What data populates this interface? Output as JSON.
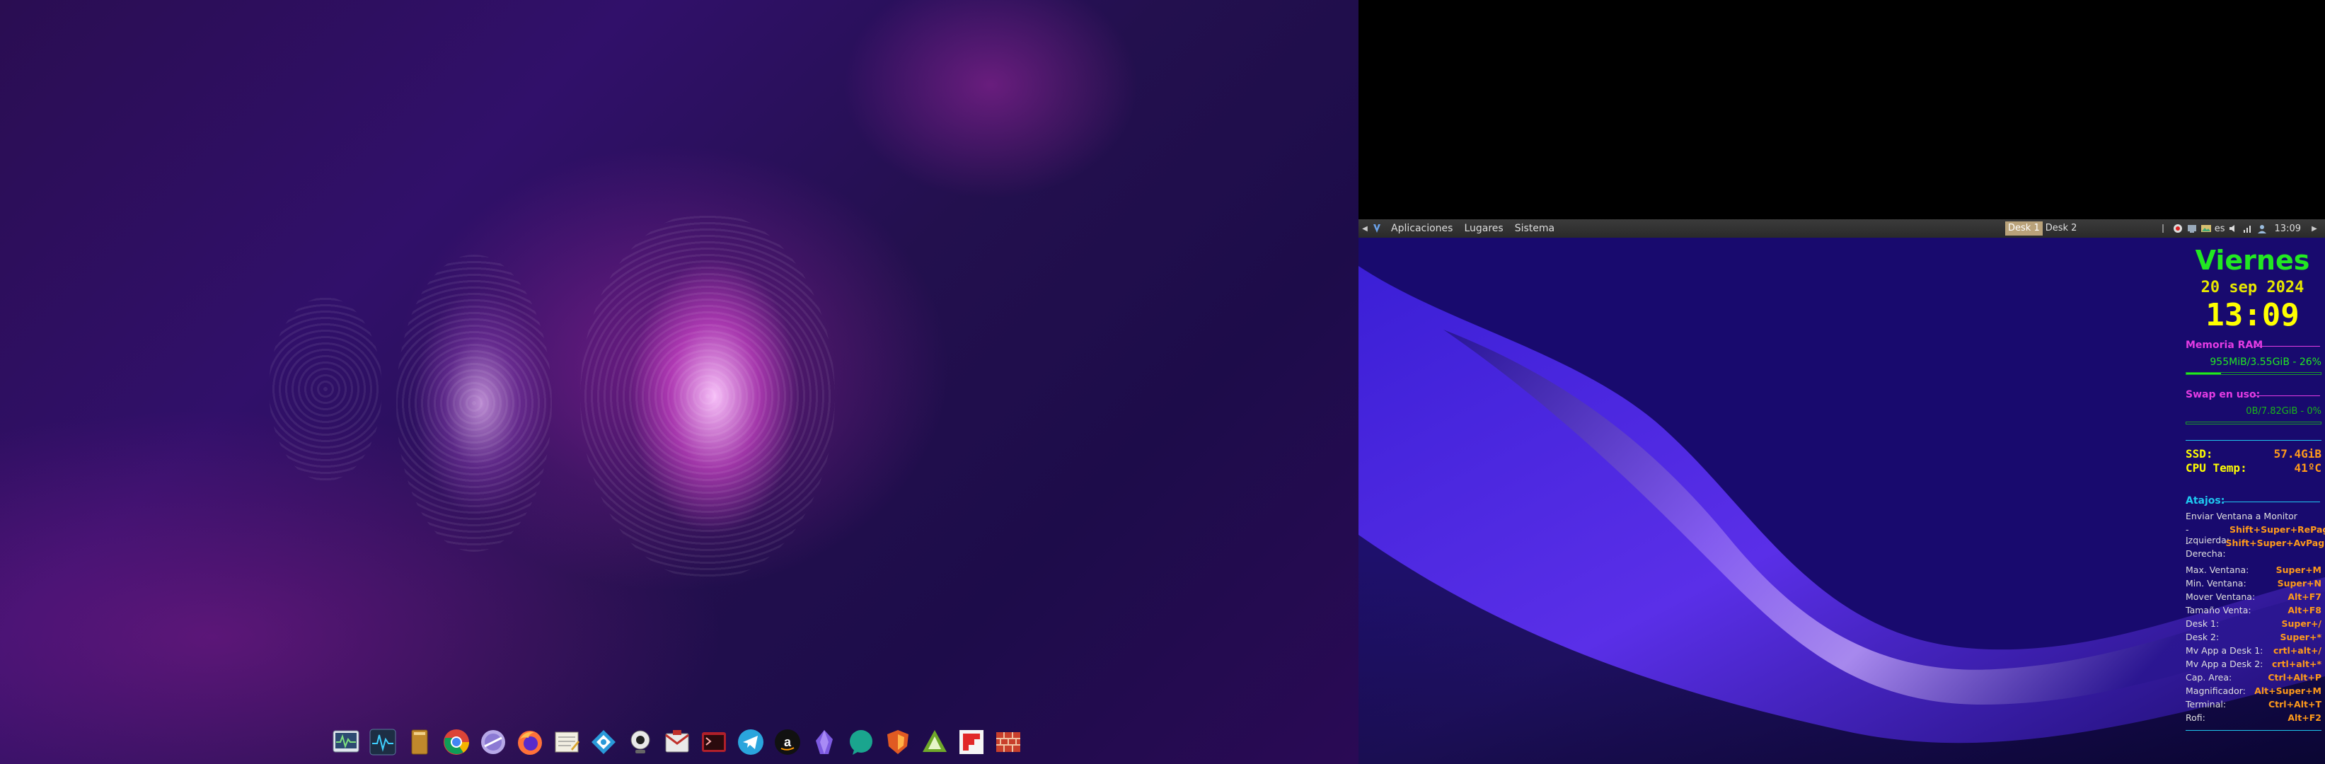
{
  "colors": {
    "panel_bg": "#2f2f2f",
    "active_desk": "#b9a27a",
    "conky_day": "#22e822",
    "conky_clock": "#ffff00",
    "conky_ram_header": "#e43ce4",
    "conky_value_green": "#22e822",
    "conky_value_orange": "#ff9a1a",
    "conky_atajos_header": "#1ec8f0"
  },
  "dock": {
    "apps": [
      {
        "icon": "system-monitor-icon"
      },
      {
        "icon": "activity-monitor-icon"
      },
      {
        "icon": "book-reader-icon"
      },
      {
        "icon": "chrome-icon"
      },
      {
        "icon": "disk-icon"
      },
      {
        "icon": "firefox-icon"
      },
      {
        "icon": "text-editor-icon"
      },
      {
        "icon": "kdeconnect-icon"
      },
      {
        "icon": "webcam-icon"
      },
      {
        "icon": "mail-icon"
      },
      {
        "icon": "terminal-icon"
      },
      {
        "icon": "telegram-icon"
      },
      {
        "icon": "amazon-icon"
      },
      {
        "icon": "obsidian-icon"
      },
      {
        "icon": "chat-icon"
      },
      {
        "icon": "shield-icon"
      },
      {
        "icon": "inkscape-icon"
      },
      {
        "icon": "flipboard-icon"
      },
      {
        "icon": "firewall-icon"
      }
    ]
  },
  "panel": {
    "menus": [
      "Aplicaciones",
      "Lugares",
      "Sistema"
    ],
    "desks": [
      "Desk 1",
      "Desk 2"
    ],
    "active_desk_index": 0,
    "keyboard_layout": "es",
    "clock": "13:09"
  },
  "conky": {
    "day": "Viernes",
    "date": "20 sep 2024",
    "time": "13:09",
    "ram": {
      "header": "Memoria RAM",
      "value": "955MiB/3.55GiB - 26%",
      "usage": 0.26
    },
    "swap": {
      "header": "Swap en uso:",
      "value": "0B/7.82GiB - 0%",
      "usage": 0
    },
    "ssd": {
      "label": "SSD:",
      "value": "57.4GiB"
    },
    "cpu": {
      "label": "CPU Temp:",
      "value": "41ºC"
    },
    "atajos": {
      "header": "Atajos:",
      "send_title": "Enviar Ventana a Monitor",
      "left_label": "-Izquierda:",
      "left_value": "Shift+Super+RePag",
      "right_label": "-Derecha:",
      "right_value": "Shift+Super+AvPag",
      "shortcuts": [
        {
          "label": "Max. Ventana:",
          "value": "Super+M"
        },
        {
          "label": "Min. Ventana:",
          "value": "Super+N"
        },
        {
          "label": "Mover Ventana:",
          "value": "Alt+F7"
        },
        {
          "label": "Tamaño Venta:",
          "value": "Alt+F8"
        },
        {
          "label": "Desk 1:",
          "value": "Super+/"
        },
        {
          "label": "Desk 2:",
          "value": "Super+*"
        },
        {
          "label": "Mv App a Desk 1:",
          "value": "crtl+alt+/"
        },
        {
          "label": "Mv App a Desk 2:",
          "value": "crtl+alt+*"
        },
        {
          "label": "Cap. Area:",
          "value": "Ctrl+Alt+P"
        },
        {
          "label": "Magnificador:",
          "value": "Alt+Super+M"
        },
        {
          "label": "Terminal:",
          "value": "Ctrl+Alt+T"
        },
        {
          "label": "Rofi:",
          "value": "Alt+F2"
        }
      ]
    }
  }
}
